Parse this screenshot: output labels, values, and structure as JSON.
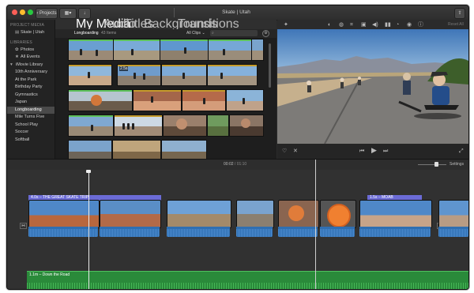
{
  "toolbar": {
    "projects_label": "Projects",
    "window_title": "Skate | Utah",
    "traffic_colors": [
      "#fc5f57",
      "#fdbc2e",
      "#28c840"
    ]
  },
  "sidebar": {
    "project_media_heading": "PROJECT MEDIA",
    "project_item": "Skate | Utah",
    "libraries_heading": "LIBRARIES",
    "libraries": [
      {
        "label": "Photos",
        "icon": "photos-icon"
      },
      {
        "label": "All Events",
        "icon": "star-icon"
      },
      {
        "label": "iMovie Library",
        "icon": "disclosure-triangle-icon"
      },
      {
        "label": "10th Anniversary"
      },
      {
        "label": "At the Park"
      },
      {
        "label": "Birthday Party"
      },
      {
        "label": "Gymnastics"
      },
      {
        "label": "Japan"
      },
      {
        "label": "Longboarding",
        "selected": true
      },
      {
        "label": "Mile Turns Five"
      },
      {
        "label": "School Play"
      },
      {
        "label": "Soccer"
      },
      {
        "label": "Softball"
      }
    ]
  },
  "tabs": [
    "My Media",
    "Audio",
    "Titles",
    "Backgrounds",
    "Transitions"
  ],
  "browser": {
    "event_title": "Longboarding",
    "item_count": "43 Items",
    "filter": "All Clips",
    "search_placeholder": "",
    "clip_badge": "2.5s"
  },
  "viewer": {
    "reset_all": "Reset All"
  },
  "timeline": {
    "timecode_current": "00:02",
    "timecode_total": "01:10",
    "timecode_sep": "/",
    "settings_label": "Settings",
    "title_clip_1": "4.0s – THE GREAT SKATE TRIP",
    "title_clip_2": "1.5s – MOAB",
    "music_clip": "1.1m – Down the Road"
  },
  "colors": {
    "accent_title": "#6b6bd6",
    "audio_blue": "#2f6fb2",
    "music_green": "#2a8a3a",
    "used_orange": "#c59b2b",
    "used_green": "#5ec25b"
  }
}
